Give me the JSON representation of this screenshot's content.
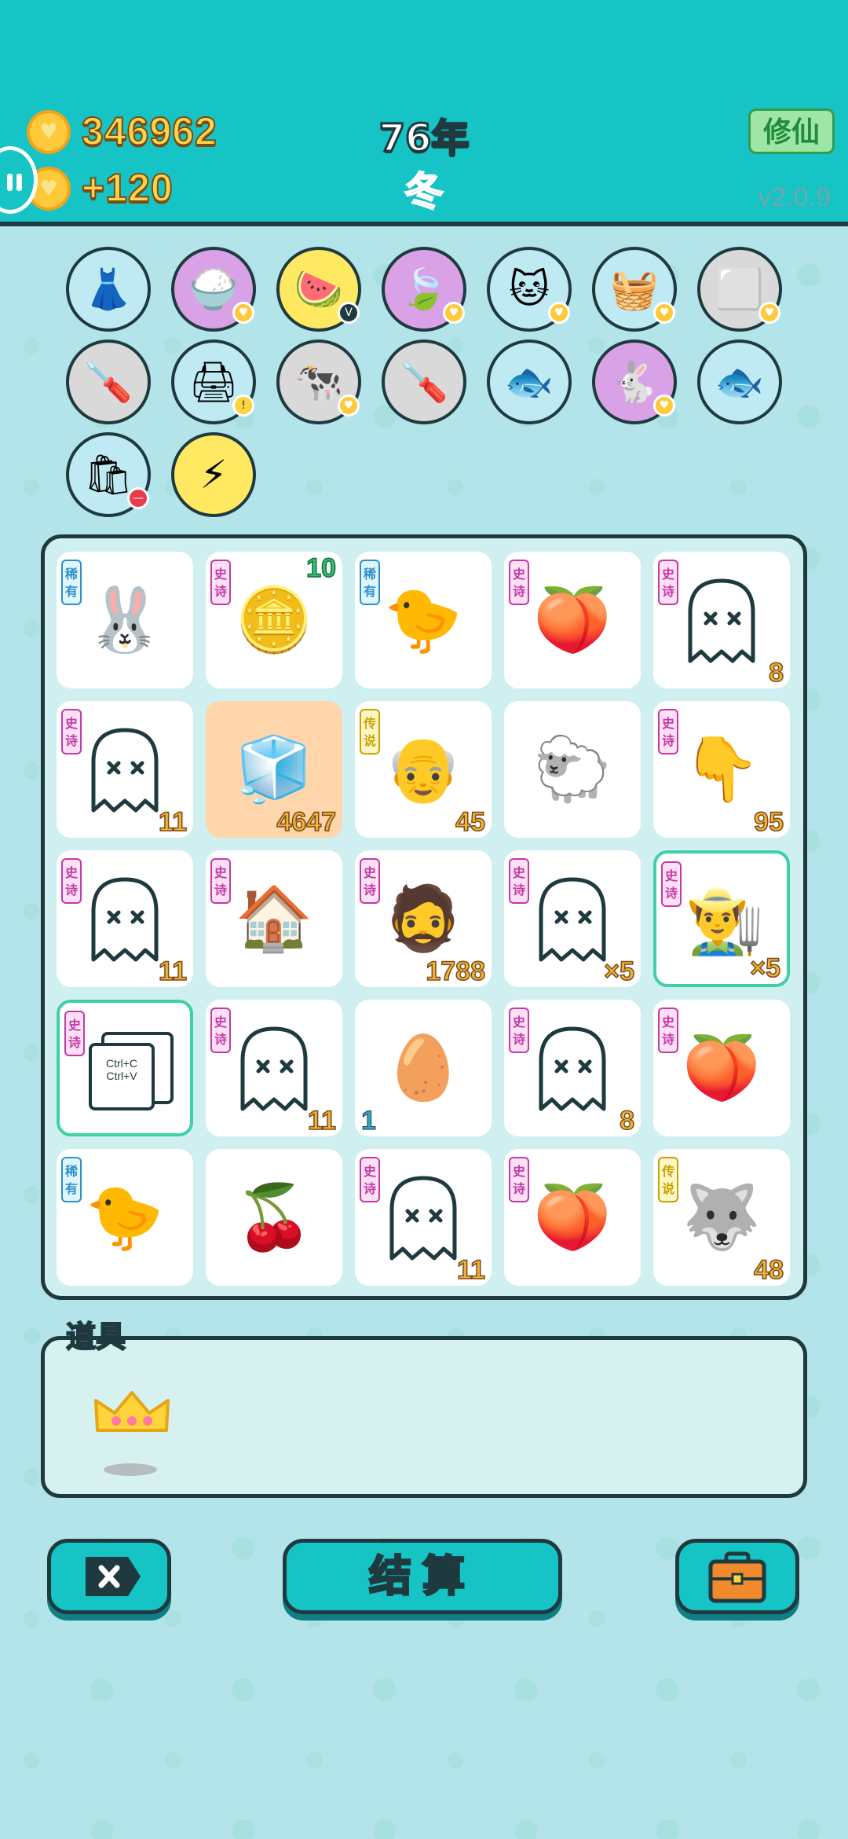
{
  "header": {
    "coins": "346962",
    "income": "+120",
    "year": "76年",
    "season": "冬",
    "mode_button": "修仙",
    "version": "v2.0.9"
  },
  "item_row": [
    {
      "icon": "skirt-icon",
      "color": "#bfeaf4"
    },
    {
      "icon": "rice-bowl-icon",
      "color": "#d9a1e6",
      "heart": true
    },
    {
      "icon": "fruit-platter-icon",
      "color": "#ffe963",
      "badge": "V"
    },
    {
      "icon": "leaf-icon",
      "color": "#d9a1e6",
      "heart": true
    },
    {
      "icon": "cat-icon",
      "color": "#bfeaf4",
      "heart": true
    },
    {
      "icon": "fruit-basket-icon",
      "color": "#bfeaf4",
      "heart": true
    },
    {
      "icon": "sugar-cubes-icon",
      "color": "#d9d9d9",
      "heart": true
    },
    {
      "icon": "screwdriver-icon",
      "color": "#d9d9d9"
    },
    {
      "icon": "printer-icon",
      "color": "#bfeaf4",
      "warning": true
    },
    {
      "icon": "cow-pair-icon",
      "color": "#d9d9d9",
      "heart": true
    },
    {
      "icon": "screwdriver-icon",
      "color": "#d9d9d9"
    },
    {
      "icon": "fish-bowl-icon",
      "color": "#bfeaf4"
    },
    {
      "icon": "rabbit-icon",
      "color": "#d9a1e6",
      "heart": true
    },
    {
      "icon": "fish-bowl-icon",
      "color": "#bfeaf4"
    },
    {
      "icon": "trash-bag-icon",
      "color": "#bfeaf4",
      "minus": true
    },
    {
      "icon": "lightning-icon",
      "color": "#ffe963"
    }
  ],
  "board": [
    {
      "tag": "稀有",
      "tagType": "rare",
      "icon": "rabbit-red-shirt-icon",
      "glyph": "🐰",
      "num": ""
    },
    {
      "tag": "史诗",
      "tagType": "epic",
      "icon": "coin-slice-icon",
      "glyph": "🪙",
      "num": "10",
      "numStyle": "green"
    },
    {
      "tag": "稀有",
      "tagType": "rare",
      "icon": "chick-icon",
      "glyph": "🐤",
      "num": ""
    },
    {
      "tag": "史诗",
      "tagType": "epic",
      "icon": "peach-icon",
      "glyph": "🍑",
      "num": ""
    },
    {
      "tag": "史诗",
      "tagType": "epic",
      "icon": "ghost-icon",
      "glyph": "ghost",
      "num": "8"
    },
    {
      "tag": "史诗",
      "tagType": "epic",
      "icon": "ghost-icon",
      "glyph": "ghost",
      "num": "11"
    },
    {
      "tag": "",
      "tagType": "",
      "icon": "fridge-icon",
      "glyph": "🧊",
      "num": "4647",
      "bg": "peach"
    },
    {
      "tag": "传说",
      "tagType": "legend",
      "icon": "old-man-glasses-icon",
      "glyph": "👴",
      "num": "45"
    },
    {
      "tag": "",
      "tagType": "",
      "icon": "sheep-icon",
      "glyph": "🐑",
      "num": ""
    },
    {
      "tag": "史诗",
      "tagType": "epic",
      "icon": "pointing-finger-icon",
      "glyph": "👇",
      "num": "95"
    },
    {
      "tag": "史诗",
      "tagType": "epic",
      "icon": "ghost-icon",
      "glyph": "ghost",
      "num": "11"
    },
    {
      "tag": "史诗",
      "tagType": "epic",
      "icon": "rabbit-house-icon",
      "glyph": "🏠",
      "num": ""
    },
    {
      "tag": "史诗",
      "tagType": "epic",
      "icon": "bearded-man-icon",
      "glyph": "🧔",
      "num": "1788"
    },
    {
      "tag": "史诗",
      "tagType": "epic",
      "icon": "ghost-icon",
      "glyph": "ghost",
      "num": "×5"
    },
    {
      "tag": "史诗",
      "tagType": "epic",
      "icon": "farmer-hat-icon",
      "glyph": "👨‍🌾",
      "num": "×5",
      "selected": true
    },
    {
      "tag": "史诗",
      "tagType": "epic",
      "icon": "copy-paste-icon",
      "glyph": "copy",
      "num": "",
      "selected": true,
      "copyText1": "Ctrl+C",
      "copyText2": "Ctrl+V"
    },
    {
      "tag": "史诗",
      "tagType": "epic",
      "icon": "ghost-icon",
      "glyph": "ghost",
      "num": "11"
    },
    {
      "tag": "",
      "tagType": "",
      "icon": "egg-icon",
      "glyph": "🥚",
      "num": "1",
      "numStyle": "left"
    },
    {
      "tag": "史诗",
      "tagType": "epic",
      "icon": "ghost-old-man-icon",
      "glyph": "ghost",
      "num": "8"
    },
    {
      "tag": "史诗",
      "tagType": "epic",
      "icon": "peach-icon",
      "glyph": "🍑",
      "num": ""
    },
    {
      "tag": "稀有",
      "tagType": "rare",
      "icon": "chick-icon",
      "glyph": "🐤",
      "num": ""
    },
    {
      "tag": "",
      "tagType": "",
      "icon": "cherry-icon",
      "glyph": "🍒",
      "num": ""
    },
    {
      "tag": "史诗",
      "tagType": "epic",
      "icon": "ghost-icon",
      "glyph": "ghost",
      "num": "11"
    },
    {
      "tag": "史诗",
      "tagType": "epic",
      "icon": "peach-icon",
      "glyph": "🍑",
      "num": ""
    },
    {
      "tag": "传说",
      "tagType": "legend",
      "icon": "husky-crown-icon",
      "glyph": "🐺",
      "num": "48"
    }
  ],
  "props": {
    "label": "道具",
    "items": [
      {
        "icon": "crown-icon"
      }
    ]
  },
  "buttons": {
    "settle": "结算"
  },
  "colors": {
    "header": "#16c3c5",
    "accent_gold": "#ffd54a",
    "season_red": "#ff4f7c"
  }
}
